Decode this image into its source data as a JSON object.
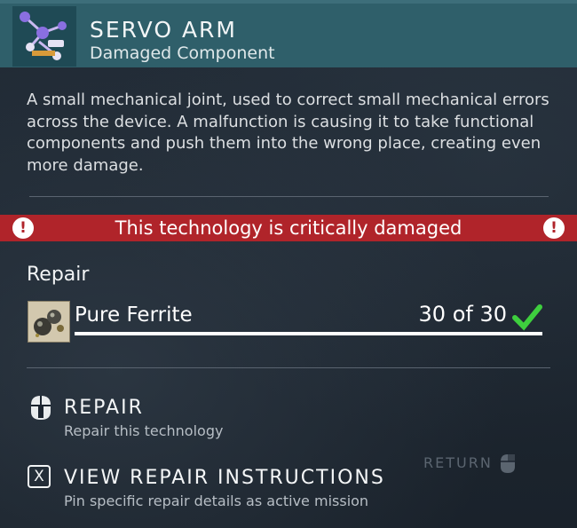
{
  "header": {
    "title": "SERVO ARM",
    "subtitle": "Damaged Component",
    "thumbnail_icon": "servo-arm-icon"
  },
  "description": "A small mechanical joint, used to correct small mechanical errors across the device. A malfunction is causing it to take functional components and push them into the wrong place, creating even more damage.",
  "warning": {
    "text": "This technology is critically damaged",
    "icon": "exclamation-icon",
    "color": "#b0242a"
  },
  "repair": {
    "heading": "Repair",
    "resource": {
      "name": "Pure Ferrite",
      "icon": "ferrite-icon",
      "count": "30 of 30",
      "progress": 1.0,
      "complete_icon": "checkmark-icon",
      "complete_color": "#3ecf3e"
    }
  },
  "actions": [
    {
      "label": "REPAIR",
      "sub": "Repair this technology",
      "icon": "mouse-icon"
    },
    {
      "label": "VIEW REPAIR INSTRUCTIONS",
      "sub": "Pin specific repair details as active mission",
      "key": "X"
    }
  ],
  "return": {
    "label": "RETURN",
    "icon": "mouse-right-icon"
  }
}
